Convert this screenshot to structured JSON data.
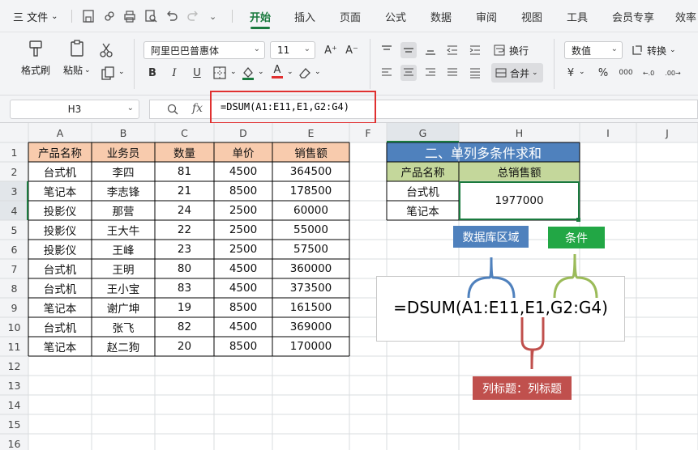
{
  "menubar": {
    "menu_file": "三 文件",
    "tabs": [
      "开始",
      "插入",
      "页面",
      "公式",
      "数据",
      "审阅",
      "视图",
      "工具",
      "会员专享",
      "效率"
    ]
  },
  "ribbon": {
    "format_painter": "格式刷",
    "paste": "粘贴",
    "font_name": "阿里巴巴普惠体",
    "font_size": "11",
    "wrap": "换行",
    "number_format": "数值",
    "convert": "转换",
    "merge": "合并",
    "currency": "¥",
    "percent": "%",
    "thousands": "000",
    "dec_inc": "←.0",
    "dec_dec": ".00→"
  },
  "formula_bar": {
    "name_box": "H3",
    "formula": "=DSUM(A1:E11,E1,G2:G4)"
  },
  "grid": {
    "columns": [
      "A",
      "B",
      "C",
      "D",
      "E",
      "F",
      "G",
      "H",
      "I",
      "J"
    ],
    "rows": [
      "1",
      "2",
      "3",
      "4",
      "5",
      "6",
      "7",
      "8",
      "9",
      "10",
      "11",
      "12",
      "13",
      "14",
      "15",
      "16"
    ],
    "headers": [
      "产品名称",
      "业务员",
      "数量",
      "单价",
      "销售额"
    ],
    "data": [
      [
        "台式机",
        "李四",
        "81",
        "4500",
        "364500"
      ],
      [
        "笔记本",
        "李志锋",
        "21",
        "8500",
        "178500"
      ],
      [
        "投影仪",
        "那营",
        "24",
        "2500",
        "60000"
      ],
      [
        "投影仪",
        "王大牛",
        "22",
        "2500",
        "55000"
      ],
      [
        "投影仪",
        "王峰",
        "23",
        "2500",
        "57500"
      ],
      [
        "台式机",
        "王明",
        "80",
        "4500",
        "360000"
      ],
      [
        "台式机",
        "王小宝",
        "83",
        "4500",
        "373500"
      ],
      [
        "笔记本",
        "谢广坤",
        "19",
        "8500",
        "161500"
      ],
      [
        "台式机",
        "张飞",
        "82",
        "4500",
        "369000"
      ],
      [
        "笔记本",
        "赵二狗",
        "20",
        "8500",
        "170000"
      ]
    ],
    "criteria_title": "二、单列多条件求和",
    "criteria_header_1": "产品名称",
    "criteria_header_2": "总销售额",
    "criteria_1": "台式机",
    "criteria_2": "笔记本",
    "result": "1977000"
  },
  "annotation": {
    "label_database": "数据库区域",
    "label_condition": "条件",
    "formula": "=DSUM(A1:E11,E1,G2:G4)",
    "label_field": "列标题：列标题"
  },
  "colors": {
    "accent_green": "#1a7a3e",
    "header_orange": "#f8cbad",
    "title_blue": "#4f81bd",
    "criteria_header_green": "#c4d79b",
    "label_blue": "#4f81bd",
    "label_green": "#22a745",
    "label_red": "#c0504d"
  }
}
